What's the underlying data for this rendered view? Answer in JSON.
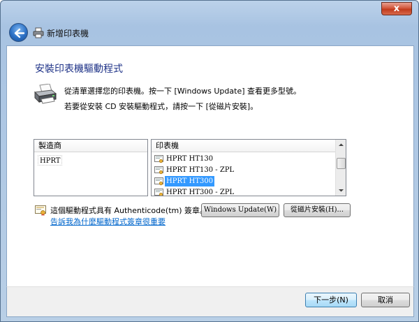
{
  "window": {
    "title": "新增印表機",
    "close_label": "x"
  },
  "page": {
    "heading": "安裝印表機驅動程式",
    "instruction_1": "從清單選擇您的印表機。按一下 [Windows Update] 查看更多型號。",
    "instruction_2": "若要從安裝 CD 安裝驅動程式，請按一下 [從磁片安裝]。"
  },
  "manufacturer_list": {
    "header": "製造商",
    "items": [
      "HPRT"
    ],
    "selected": "HPRT"
  },
  "printer_list": {
    "header": "印表機",
    "items": [
      "HPRT HT130",
      "HPRT HT130 - ZPL",
      "HPRT HT300",
      "HPRT HT300 - ZPL"
    ],
    "selected": "HPRT HT300"
  },
  "signature": {
    "text": "這個驅動程式具有 Authenticode(tm) 簽章。",
    "link": "告訴我為什麼驅動程式簽章很重要"
  },
  "buttons": {
    "windows_update": "Windows Update(W)",
    "have_disk": "從磁片安裝(H)...",
    "next": "下一步(N)",
    "cancel": "取消"
  },
  "colors": {
    "heading": "#1e3287",
    "link": "#0066cc",
    "selection": "#3399ff"
  }
}
